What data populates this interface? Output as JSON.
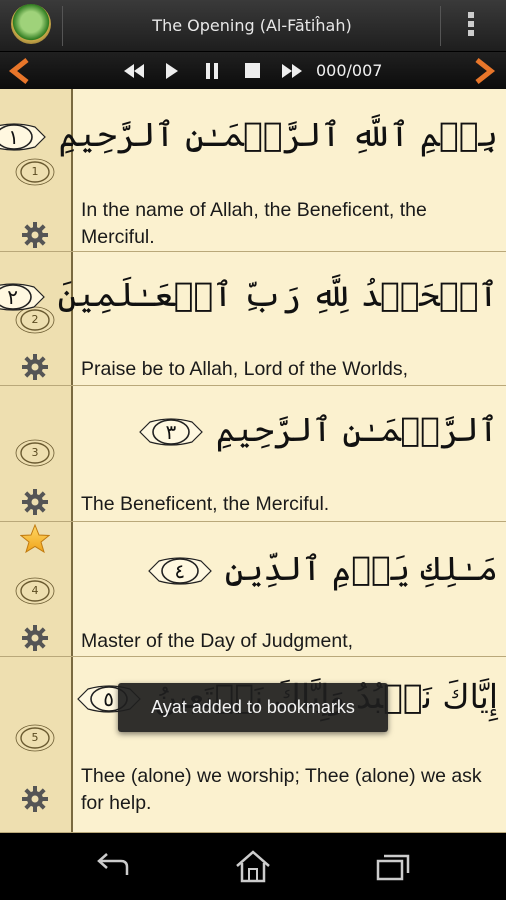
{
  "app": {
    "title": "The Opening (Al-Fātiĥah)"
  },
  "player": {
    "counter": "000/007"
  },
  "icons": {
    "logo": "app-logo-icon",
    "menu": "overflow-menu-icon",
    "prev": "previous-surah-icon",
    "rewind": "rewind-icon",
    "play": "play-icon",
    "pause": "pause-icon",
    "stop": "stop-icon",
    "forward": "fast-forward-icon",
    "next": "next-surah-icon",
    "gear": "gear-icon",
    "bookmark": "star-bookmark-icon",
    "back": "back-icon",
    "home": "home-icon",
    "recents": "recent-apps-icon"
  },
  "colors": {
    "accent": "#e8762a",
    "page": "#fbf1cf",
    "sidebar": "#eedfb0"
  },
  "verses": [
    {
      "number": "1",
      "marker": "١",
      "arabic": "بِسۡمِ ٱللَّهِ ٱلرَّحۡمَـٰنِ ٱلرَّحِيمِ",
      "translation": "In the name of Allah, the Beneficent, the Merciful.",
      "bookmarked": false
    },
    {
      "number": "2",
      "marker": "٢",
      "arabic": "ٱلۡحَمۡدُ لِلَّهِ رَبِّ ٱلۡعَـٰلَمِينَ",
      "translation": "Praise be to Allah, Lord of the Worlds,",
      "bookmarked": false
    },
    {
      "number": "3",
      "marker": "٣",
      "arabic": "ٱلرَّحۡمَـٰنِ ٱلرَّحِيمِ",
      "translation": "The Beneficent, the Merciful.",
      "bookmarked": false
    },
    {
      "number": "4",
      "marker": "٤",
      "arabic": "مَـٰلِكِ يَوۡمِ ٱلدِّينِ",
      "translation": "Master of the Day of Judgment,",
      "bookmarked": true
    },
    {
      "number": "5",
      "marker": "٥",
      "arabic": "إِيَّاكَ نَعۡبُدُ وَإِيَّاكَ نَسۡتَعِينُ",
      "translation": "Thee (alone) we worship; Thee (alone) we ask for help.",
      "bookmarked": false
    }
  ],
  "toast": {
    "message": "Ayat added to bookmarks"
  }
}
